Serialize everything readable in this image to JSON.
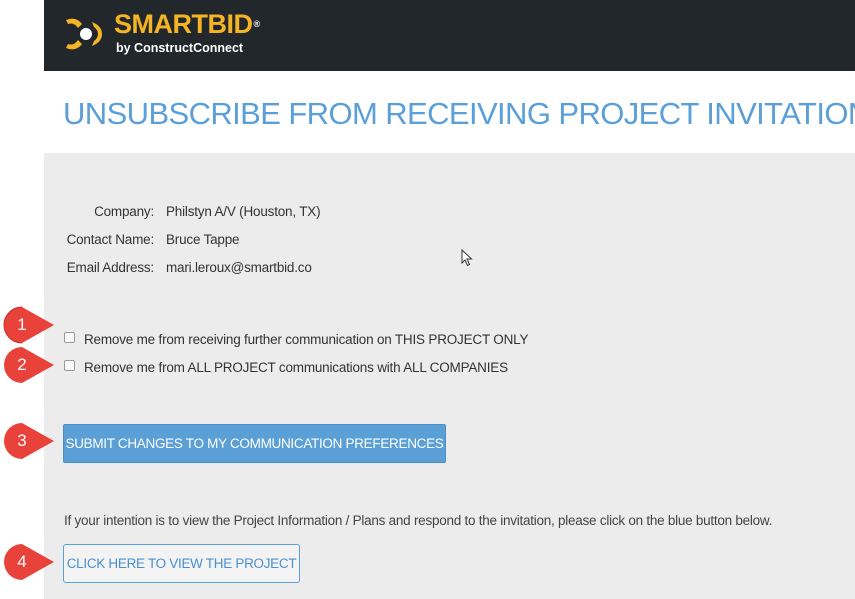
{
  "header": {
    "logo_word": "SMARTBID",
    "logo_reg": "®",
    "logo_sub": "by ConstructConnect"
  },
  "title": "UNSUBSCRIBE FROM RECEIVING PROJECT INVITATIONS",
  "info": {
    "company_label": "Company:",
    "company_value": "Philstyn A/V (Houston, TX)",
    "contact_label": "Contact Name:",
    "contact_value": "Bruce Tappe",
    "email_label": "Email Address:",
    "email_value": "mari.leroux@smartbid.co"
  },
  "options": [
    {
      "label": "Remove me from receiving further communication on THIS PROJECT ONLY",
      "checked": false
    },
    {
      "label": "Remove me from ALL PROJECT communications with ALL COMPANIES",
      "checked": false
    }
  ],
  "submit_label": "SUBMIT CHANGES TO MY COMMUNICATION PREFERENCES",
  "intent_text": "If your intention is to view the Project Information / Plans and respond to the invitation, please click on the blue button below.",
  "view_label": "CLICK HERE TO VIEW THE PROJECT",
  "markers": [
    "1",
    "2",
    "3",
    "4"
  ],
  "colors": {
    "header_bg": "#22272b",
    "brand_yellow": "#f5b425",
    "title_blue": "#5b9fd8",
    "button_blue": "#5a9fd6",
    "panel_bg": "#ececec",
    "marker_red": "#e8423a"
  },
  "icons": {
    "logo": "smartbid-logo-icon",
    "cursor": "mouse-pointer-icon"
  }
}
